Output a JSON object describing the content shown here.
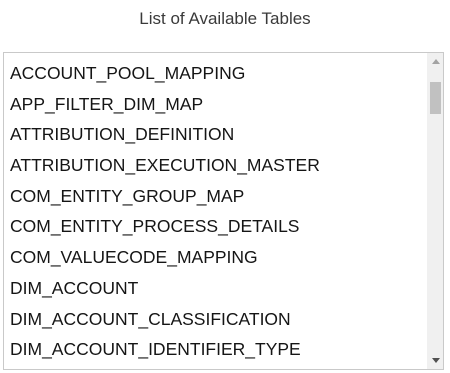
{
  "panel": {
    "title": "List of Available Tables"
  },
  "tables": [
    "ACCOUNT_POOL_MAPPING",
    "APP_FILTER_DIM_MAP",
    "ATTRIBUTION_DEFINITION",
    "ATTRIBUTION_EXECUTION_MASTER",
    "COM_ENTITY_GROUP_MAP",
    "COM_ENTITY_PROCESS_DETAILS",
    "COM_VALUECODE_MAPPING",
    "DIM_ACCOUNT",
    "DIM_ACCOUNT_CLASSIFICATION",
    "DIM_ACCOUNT_IDENTIFIER_TYPE"
  ],
  "scrollbar": {
    "up_icon": "scroll-up-arrow",
    "down_icon": "scroll-down-arrow"
  }
}
